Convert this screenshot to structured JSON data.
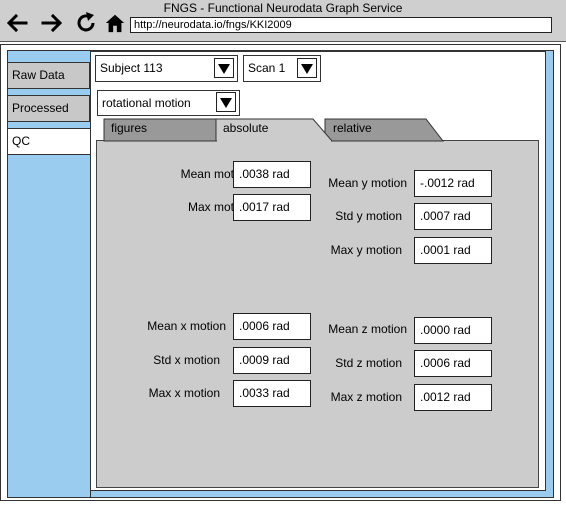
{
  "browser": {
    "title": "FNGS - Functional Neurodata Graph Service",
    "url": "http://neurodata.io/fngs/KKI2009"
  },
  "sidebar": {
    "items": [
      {
        "label": "Raw Data"
      },
      {
        "label": "Processed"
      },
      {
        "label": "QC"
      }
    ]
  },
  "selectors": {
    "subject": "Subject 113",
    "scan": "Scan 1",
    "metric": "rotational motion"
  },
  "tabs": [
    {
      "label": "figures"
    },
    {
      "label": "absolute"
    },
    {
      "label": "relative"
    }
  ],
  "stats": {
    "mean_motion": {
      "label": "Mean motion",
      "value": ".0038 rad"
    },
    "max_motion": {
      "label": "Max motion",
      "value": ".0017 rad"
    },
    "mean_y": {
      "label": "Mean y motion",
      "value": "-.0012 rad"
    },
    "std_y": {
      "label": "Std y motion",
      "value": ".0007 rad"
    },
    "max_y": {
      "label": "Max y motion",
      "value": ".0001 rad"
    },
    "mean_x": {
      "label": "Mean x motion",
      "value": ".0006 rad"
    },
    "std_x": {
      "label": "Std x motion",
      "value": ".0009 rad"
    },
    "max_x": {
      "label": "Max x motion",
      "value": ".0033 rad"
    },
    "mean_z": {
      "label": "Mean z motion",
      "value": ".0000 rad"
    },
    "std_z": {
      "label": "Std z motion",
      "value": ".0006 rad"
    },
    "max_z": {
      "label": "Max z motion",
      "value": ".0012 rad"
    }
  }
}
